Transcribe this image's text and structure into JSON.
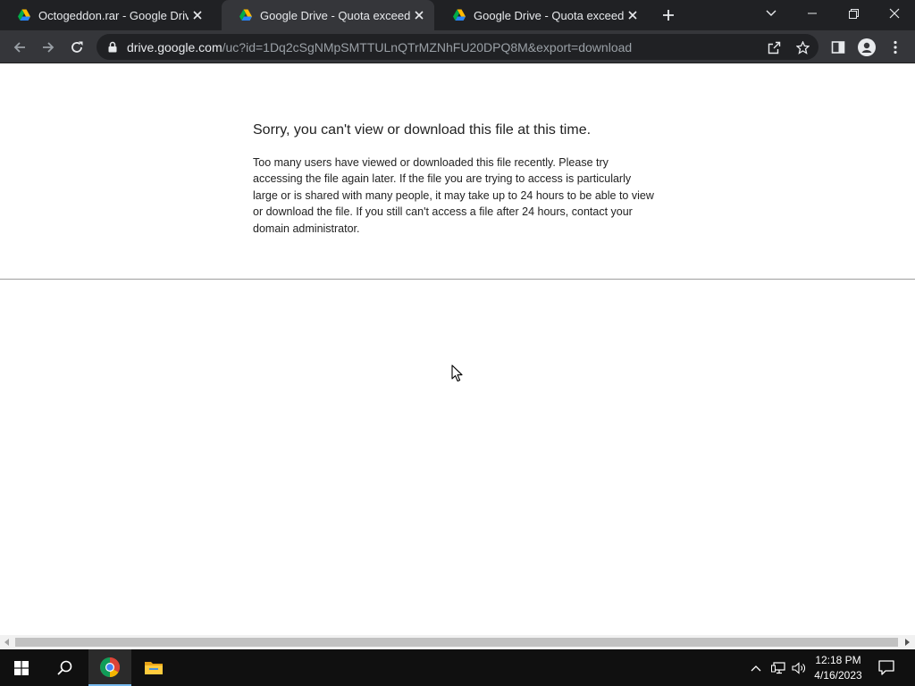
{
  "browser": {
    "tabs": [
      {
        "title": "Octogeddon.rar - Google Drive"
      },
      {
        "title": "Google Drive - Quota exceeded"
      },
      {
        "title": "Google Drive - Quota exceeded"
      }
    ],
    "url": {
      "host": "drive.google.com",
      "path": "/uc?id=1Dq2cSgNMpSMTTULnQTrMZNhFU20DPQ8M&export=download"
    },
    "icons": [
      "google-drive-icon",
      "close-icon",
      "plus-icon",
      "chevron-down-icon",
      "minimize-icon",
      "restore-icon",
      "back-icon",
      "forward-icon",
      "reload-icon",
      "lock-icon",
      "share-icon",
      "star-icon",
      "side-panel-icon",
      "profile-icon",
      "menu-icon"
    ]
  },
  "page": {
    "heading": "Sorry, you can't view or download this file at this time.",
    "body": "Too many users have viewed or downloaded this file recently. Please try accessing the file again later. If the file you are trying to access is particularly large or is shared with many people, it may take up to 24 hours to be able to view or download the file. If you still can't access a file after 24 hours, contact your domain administrator."
  },
  "taskbar": {
    "time": "12:18 PM",
    "date": "4/16/2023"
  },
  "colors": {
    "tabstrip": "#202124",
    "toolbar": "#35363a",
    "taskbar": "#101010",
    "accent": "#76b9ed"
  }
}
